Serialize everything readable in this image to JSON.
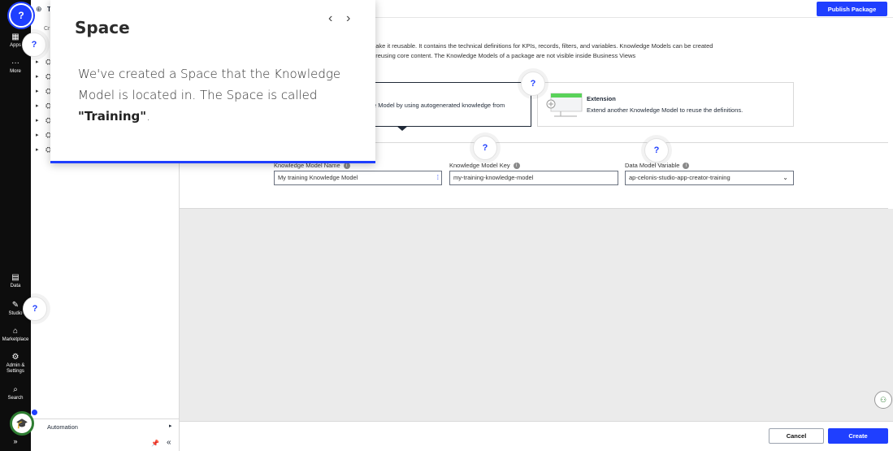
{
  "rail": {
    "items": [
      {
        "label": "Apps",
        "icon": "grid-icon"
      },
      {
        "label": "More",
        "icon": "dots-icon"
      },
      {
        "label": "Data",
        "icon": "database-icon"
      },
      {
        "label": "Studio",
        "icon": "studio-icon"
      },
      {
        "label": "Marketplace",
        "icon": "store-icon"
      },
      {
        "label": "Admin & Settings",
        "icon": "sliders-icon"
      },
      {
        "label": "Search",
        "icon": "search-icon"
      }
    ],
    "expand_glyph": "»"
  },
  "tree": {
    "header_fragment": "T",
    "create_fragment": "Cr",
    "space_icon": "⛭",
    "rows": [
      "",
      "",
      "",
      "",
      "",
      "",
      ""
    ],
    "footer": {
      "automation_label": "Automation"
    }
  },
  "topbar": {
    "publish_label": "Publish Package"
  },
  "description": {
    "line1": "make it reusable. It contains the technical definitions for KPIs, records, filters, and variables. Knowledge Models can be created",
    "line2": "e reusing core content. The Knowledge Models of a package are not visible inside Business Views"
  },
  "cards": {
    "auto": {
      "text_fragment": "e Model by using autogenerated knowledge from"
    },
    "extension": {
      "title": "Extension",
      "text": "Extend another Knowledge Model to reuse the definitions."
    }
  },
  "form": {
    "name_label": "Knowledge Model Name",
    "name_value": "My training Knowledge Model",
    "key_label": "Knowledge Model Key",
    "key_value": "my-training-knowledge-model",
    "variable_label": "Data Model Variable",
    "variable_value": "ap-celonis-studio-app-creator-training"
  },
  "footer": {
    "cancel_label": "Cancel",
    "create_label": "Create"
  },
  "tour": {
    "title": "Space",
    "body_prefix": "We've created a Space that the Knowledge Model is located in. The Space is called ",
    "body_highlight": "\"Training\"",
    "body_suffix": ".",
    "prev_glyph": "‹",
    "next_glyph": "›"
  },
  "help_glyph": "?",
  "colors": {
    "accent": "#1f3fff",
    "rail": "#0d0d0d",
    "gray_area": "#ebebeb"
  }
}
